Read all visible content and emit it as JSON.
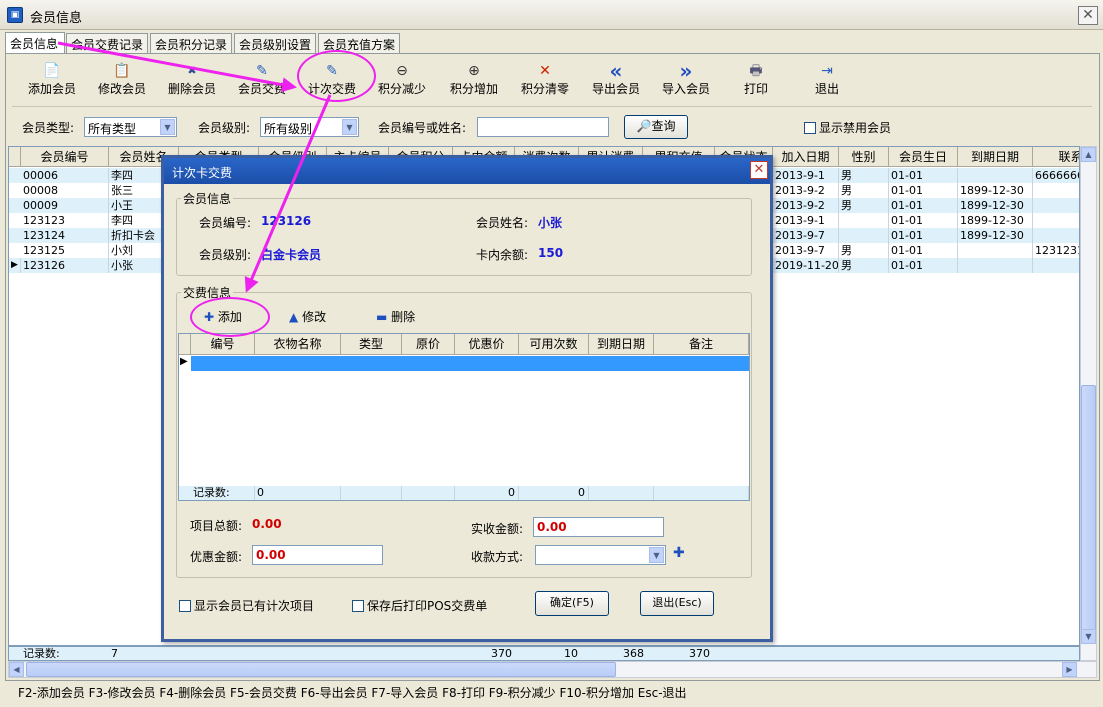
{
  "window": {
    "title": "会员信息",
    "close": "✕"
  },
  "tabs": [
    "会员信息",
    "会员交费记录",
    "会员积分记录",
    "会员级别设置",
    "会员充值方案"
  ],
  "toolbar": [
    {
      "label": "添加会员",
      "icon": "📄"
    },
    {
      "label": "修改会员",
      "icon": "📋"
    },
    {
      "label": "删除会员",
      "icon": "✖"
    },
    {
      "label": "会员交费",
      "icon": "✎"
    },
    {
      "label": "计次交费",
      "icon": "✎"
    },
    {
      "label": "积分减少",
      "icon": "⊖"
    },
    {
      "label": "积分增加",
      "icon": "⊕"
    },
    {
      "label": "积分清零",
      "icon": "✕"
    },
    {
      "label": "导出会员",
      "icon": "«"
    },
    {
      "label": "导入会员",
      "icon": "»"
    },
    {
      "label": "打印",
      "icon": "🖶"
    },
    {
      "label": "退出",
      "icon": "⇥"
    }
  ],
  "filter": {
    "type_label": "会员类型:",
    "type_value": "所有类型",
    "level_label": "会员级别:",
    "level_value": "所有级别",
    "search_label": "会员编号或姓名:",
    "search_value": "",
    "query_label": "查询",
    "show_disabled_label": "显示禁用会员"
  },
  "grid": {
    "headers": [
      "会员编号",
      "会员姓名",
      "会员类型",
      "会员级别",
      "主卡编号",
      "会员积分",
      "卡内余额",
      "消费次数",
      "累计消费",
      "累积充值",
      "会员状态",
      "加入日期",
      "性别",
      "会员生日",
      "到期日期",
      "联系"
    ],
    "rows": [
      [
        "00006",
        "李四",
        "",
        "",
        "",
        "",
        "",
        "",
        "",
        "",
        "",
        "2013-9-1",
        "男",
        "01-01",
        "",
        "6666666"
      ],
      [
        "00008",
        "张三",
        "",
        "",
        "",
        "",
        "",
        "",
        "",
        "",
        "",
        "2013-9-2",
        "男",
        "01-01",
        "1899-12-30",
        ""
      ],
      [
        "00009",
        "小王",
        "",
        "",
        "",
        "",
        "",
        "",
        "",
        "",
        "",
        "2013-9-2",
        "男",
        "01-01",
        "1899-12-30",
        ""
      ],
      [
        "123123",
        "李四",
        "",
        "",
        "",
        "",
        "",
        "",
        "",
        "",
        "",
        "2013-9-1",
        "",
        "01-01",
        "1899-12-30",
        ""
      ],
      [
        "123124",
        "折扣卡会",
        "",
        "",
        "",
        "",
        "",
        "",
        "",
        "",
        "",
        "2013-9-7",
        "",
        "01-01",
        "1899-12-30",
        ""
      ],
      [
        "123125",
        "小刘",
        "",
        "",
        "",
        "",
        "",
        "",
        "",
        "",
        "",
        "2013-9-7",
        "男",
        "01-01",
        "",
        "1231231"
      ],
      [
        "123126",
        "小张",
        "",
        "",
        "",
        "",
        "",
        "",
        "",
        "",
        "",
        "2019-11-20",
        "男",
        "01-01",
        "",
        ""
      ]
    ],
    "footer_label": "记录数:",
    "footer_count": "7",
    "footer_values": {
      "score": "370",
      "visits": "10",
      "consume": "368",
      "recharge": "370"
    }
  },
  "statusbar": "F2-添加会员 F3-修改会员 F4-删除会员 F5-会员交费 F6-导出会员 F7-导入会员 F8-打印 F9-积分减少 F10-积分增加 Esc-退出",
  "dialog": {
    "title": "计次卡交费",
    "close": "✕",
    "member_group": "会员信息",
    "member_no_label": "会员编号:",
    "member_no": "123126",
    "member_name_label": "会员姓名:",
    "member_name": "小张",
    "member_level_label": "会员级别:",
    "member_level": "白金卡会员",
    "balance_label": "卡内余额:",
    "balance": "150",
    "fee_group": "交费信息",
    "add": "添加",
    "edit": "修改",
    "delete": "删除",
    "sub_headers": [
      "编号",
      "衣物名称",
      "类型",
      "原价",
      "优惠价",
      "可用次数",
      "到期日期",
      "备注"
    ],
    "sub_footer_label": "记录数:",
    "sub_footer_count": "0",
    "sub_footer_price": "0",
    "sub_footer_times": "0",
    "total_label": "项目总额:",
    "total": "0.00",
    "paid_label": "实收金额:",
    "paid": "0.00",
    "discount_label": "优惠金额:",
    "discount": "0.00",
    "pay_method_label": "收款方式:",
    "pay_method": "",
    "show_existing_label": "显示会员已有计次项目",
    "print_pos_label": "保存后打印POS交费单",
    "ok": "确定(F5)",
    "exit": "退出(Esc)"
  },
  "colors": {
    "highlight": "#ee22ee",
    "selection": "#3399ff",
    "alt_row": "#def0fa",
    "dialog_title": "#1b4ea8"
  }
}
